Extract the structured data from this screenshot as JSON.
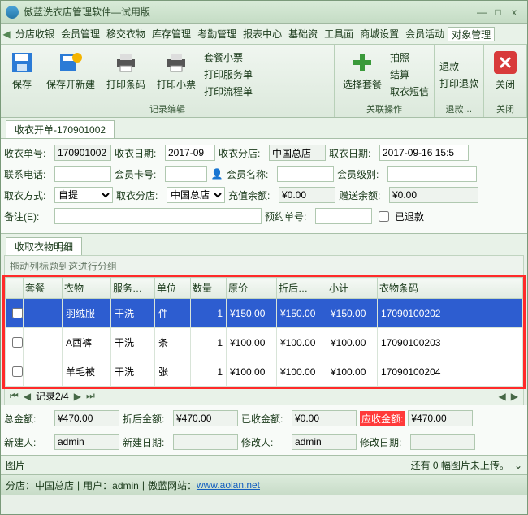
{
  "app": {
    "title": "傲蓝洗衣店管理软件—试用版"
  },
  "menu": {
    "items": [
      "分店收银",
      "会员管理",
      "移交衣物",
      "库存管理",
      "考勤管理",
      "报表中心",
      "基础资",
      "工具面",
      "商城设置",
      "会员活动",
      "对象管理"
    ]
  },
  "ribbon": {
    "save": "保存",
    "saveNew": "保存开新建",
    "printBarcode": "打印条码",
    "printTicket": "打印小票",
    "pkgLines": [
      "套餐小票",
      "打印服务单",
      "打印流程单"
    ],
    "selPkg": "选择套餐",
    "photoLines": [
      "拍照",
      "结算",
      "取衣短信"
    ],
    "refund": "退款",
    "printRefund": "打印退款",
    "close": "关闭",
    "grpEdit": "记录编辑",
    "grpRel": "关联操作",
    "grpRefund": "退款…",
    "grpClose": "关闭"
  },
  "tab": {
    "title": "收衣开单-170901002"
  },
  "form": {
    "orderNoLbl": "收衣单号:",
    "orderNo": "170901002",
    "dateLbl": "收衣日期:",
    "date": "2017-09",
    "branchLbl": "收衣分店:",
    "branch": "中国总店",
    "pickupDateLbl": "取衣日期:",
    "pickupDate": "2017-09-16 15:5",
    "phoneLbl": "联系电话:",
    "phone": "",
    "cardLbl": "会员卡号:",
    "card": "",
    "memberLbl": "会员名称:",
    "member": "",
    "levelLbl": "会员级别:",
    "pickupWayLbl": "取衣方式:",
    "pickupWay": "自提",
    "pickupBranchLbl": "取衣分店:",
    "pickupBranch": "中国总店",
    "rechargeLbl": "充值余额:",
    "recharge": "¥0.00",
    "bonusLbl": "赠送余额:",
    "bonus": "¥0.00",
    "remarkLbl": "备注(E):",
    "remark": "",
    "reserveLbl": "预约单号:",
    "reserve": "",
    "refundedLbl": "已退款"
  },
  "subtab": "收取衣物明细",
  "groupHint": "拖动列标题到这进行分组",
  "cols": [
    "",
    "套餐",
    "衣物",
    "服务…",
    "单位",
    "数量",
    "原价",
    "折后…",
    "小计",
    "衣物条码"
  ],
  "rows": [
    {
      "pkg": "",
      "cloth": "羽绒服",
      "svc": "干洗",
      "unit": "件",
      "qty": "1",
      "price": "¥150.00",
      "after": "¥150.00",
      "sub": "¥150.00",
      "code": "17090100202"
    },
    {
      "pkg": "",
      "cloth": "A西裤",
      "svc": "干洗",
      "unit": "条",
      "qty": "1",
      "price": "¥100.00",
      "after": "¥100.00",
      "sub": "¥100.00",
      "code": "17090100203"
    },
    {
      "pkg": "",
      "cloth": "羊毛被",
      "svc": "干洗",
      "unit": "张",
      "qty": "1",
      "price": "¥100.00",
      "after": "¥100.00",
      "sub": "¥100.00",
      "code": "17090100204"
    }
  ],
  "pager": "记录2/4",
  "totals": {
    "totalLbl": "总金额:",
    "total": "¥470.00",
    "afterLbl": "折后金额:",
    "after": "¥470.00",
    "paidLbl": "已收金额:",
    "paid": "¥0.00",
    "dueLbl": "应收金额:",
    "due": "¥470.00",
    "creatorLbl": "新建人:",
    "creator": "admin",
    "createDateLbl": "新建日期:",
    "createDate": "",
    "modifierLbl": "修改人:",
    "modifier": "admin",
    "modifyDateLbl": "修改日期:",
    "modifyDate": ""
  },
  "img": {
    "title": "图片",
    "hint": "还有 0 幅图片未上传。"
  },
  "status": {
    "branch": "分店：中国总店",
    "user": "用户：admin",
    "siteLbl": "傲蓝网站：",
    "site": "www.aolan.net"
  },
  "chart_data": {
    "type": "table",
    "title": "收取衣物明细",
    "columns": [
      "套餐",
      "衣物",
      "服务",
      "单位",
      "数量",
      "原价",
      "折后",
      "小计",
      "衣物条码"
    ],
    "rows": [
      [
        "",
        "羽绒服",
        "干洗",
        "件",
        1,
        150.0,
        150.0,
        150.0,
        "17090100202"
      ],
      [
        "",
        "A西裤",
        "干洗",
        "条",
        1,
        100.0,
        100.0,
        100.0,
        "17090100203"
      ],
      [
        "",
        "羊毛被",
        "干洗",
        "张",
        1,
        100.0,
        100.0,
        100.0,
        "17090100204"
      ]
    ],
    "totals": {
      "总金额": 470.0,
      "折后金额": 470.0,
      "已收金额": 0.0,
      "应收金额": 470.0
    }
  }
}
